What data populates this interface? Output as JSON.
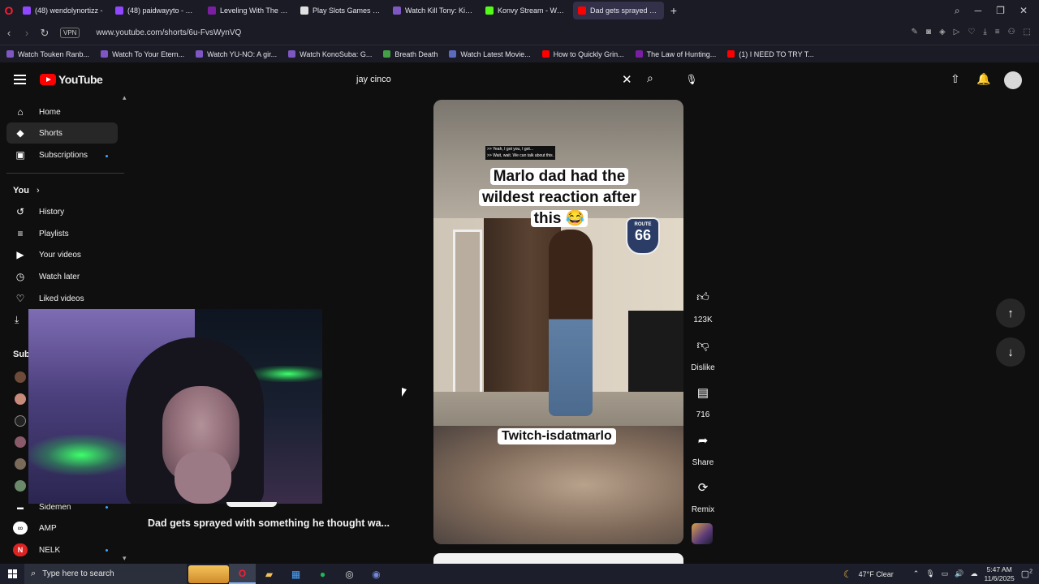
{
  "browser": {
    "tabs": [
      {
        "label": "(48) wendolynortizz -",
        "color": "#9146ff"
      },
      {
        "label": "(48) paidwayyto - Twitch",
        "color": "#9146ff"
      },
      {
        "label": "Leveling With The Gods -",
        "color": "#7b1fa2"
      },
      {
        "label": "Play Slots Games for Free",
        "color": "#e0e0e0"
      },
      {
        "label": "Watch Kill Tony: Kill or Be",
        "color": "#7e57c2"
      },
      {
        "label": "Konvy Stream - Watch",
        "color": "#53fc18"
      },
      {
        "label": "Dad gets sprayed with",
        "color": "#ff0000"
      }
    ],
    "new_tab": "+",
    "vpn_badge": "VPN",
    "url": "www.youtube.com/shorts/6u-FvsWynVQ",
    "bookmarks": [
      {
        "label": "Watch Touken Ranb...",
        "color": "#7e57c2"
      },
      {
        "label": "Watch To Your Etern...",
        "color": "#7e57c2"
      },
      {
        "label": "Watch YU-NO: A gir...",
        "color": "#7e57c2"
      },
      {
        "label": "Watch KonoSuba: G...",
        "color": "#7e57c2"
      },
      {
        "label": "Breath Death",
        "color": "#43a047"
      },
      {
        "label": "Watch Latest Movie...",
        "color": "#5c6bc0"
      },
      {
        "label": "How to Quickly Grin...",
        "color": "#ff0000"
      },
      {
        "label": "The Law of Hunting...",
        "color": "#7b1fa2"
      },
      {
        "label": "(1) I NEED TO TRY T...",
        "color": "#ff0000"
      }
    ]
  },
  "youtube": {
    "logo_text": "YouTube",
    "search_value": "jay cinco",
    "sidebar": {
      "items": [
        {
          "label": "Home",
          "icon": "home-icon",
          "glyph": "⌂"
        },
        {
          "label": "Shorts",
          "icon": "shorts-icon",
          "glyph": "◆"
        },
        {
          "label": "Subscriptions",
          "icon": "subscriptions-icon",
          "glyph": "▣"
        }
      ],
      "you_heading": "You",
      "you_chevron": "›",
      "you_items": [
        {
          "label": "History",
          "icon": "history-icon",
          "glyph": "↺"
        },
        {
          "label": "Playlists",
          "icon": "playlists-icon",
          "glyph": "≡"
        },
        {
          "label": "Your videos",
          "icon": "your-videos-icon",
          "glyph": "▶"
        },
        {
          "label": "Watch later",
          "icon": "watch-later-icon",
          "glyph": "◷"
        },
        {
          "label": "Liked videos",
          "icon": "liked-videos-icon",
          "glyph": "👍"
        }
      ],
      "subscriptions_heading": "Sub",
      "channels": [
        {
          "label": "Sidemen"
        },
        {
          "label": "AMP"
        },
        {
          "label": "NELK"
        }
      ]
    },
    "short": {
      "caption_small_1": ">> Yeah, I got you, I got...",
      "caption_small_2": ">> Wait, wait. We can talk about this.",
      "caption_main": "Marlo dad had the wildest reaction after this 😂",
      "route_text": "ROUTE",
      "route_number": "66",
      "watermark": "Twitch-isdatmarlo",
      "title": "Dad gets sprayed with something he thought wa..."
    },
    "actions": {
      "like_count": "123K",
      "dislike_label": "Dislike",
      "comment_count": "716",
      "share_label": "Share",
      "remix_label": "Remix"
    }
  },
  "taskbar": {
    "search_placeholder": "Type here to search",
    "weather": "47°F  Clear",
    "time": "5:47 AM",
    "date": "11/6/2025",
    "notification_count": "2"
  }
}
